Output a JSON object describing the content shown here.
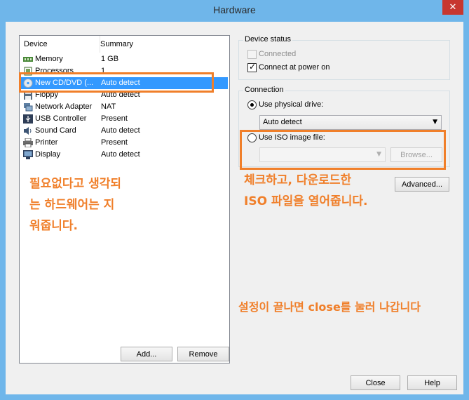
{
  "window": {
    "title": "Hardware"
  },
  "device_list": {
    "headers": {
      "device": "Device",
      "summary": "Summary"
    },
    "rows": [
      {
        "name": "Memory",
        "summary": "1 GB",
        "icon": "memory-icon"
      },
      {
        "name": "Processors",
        "summary": "1",
        "icon": "processor-icon"
      },
      {
        "name": "New CD/DVD (...",
        "summary": "Auto detect",
        "icon": "cd-dvd-icon",
        "selected": true
      },
      {
        "name": "Floppy",
        "summary": "Auto detect",
        "icon": "floppy-icon"
      },
      {
        "name": "Network Adapter",
        "summary": "NAT",
        "icon": "network-adapter-icon"
      },
      {
        "name": "USB Controller",
        "summary": "Present",
        "icon": "usb-icon"
      },
      {
        "name": "Sound Card",
        "summary": "Auto detect",
        "icon": "sound-card-icon"
      },
      {
        "name": "Printer",
        "summary": "Present",
        "icon": "printer-icon"
      },
      {
        "name": "Display",
        "summary": "Auto detect",
        "icon": "display-icon"
      }
    ]
  },
  "buttons": {
    "add": "Add...",
    "remove": "Remove",
    "advanced": "Advanced...",
    "close": "Close",
    "help": "Help",
    "browse": "Browse..."
  },
  "device_status": {
    "label": "Device status",
    "connected": {
      "label": "Connected",
      "checked": false,
      "enabled": false
    },
    "connect_at_power_on": {
      "label": "Connect at power on",
      "checked": true
    }
  },
  "connection": {
    "label": "Connection",
    "physical_drive": {
      "label": "Use physical drive:",
      "selected": true,
      "value": "Auto detect"
    },
    "iso_image": {
      "label": "Use ISO image file:",
      "selected": false,
      "value": ""
    }
  },
  "annotations": {
    "left_note": [
      "필요없다고 생각되",
      "는 하드웨어는 지",
      "워줍니다."
    ],
    "right_note": [
      "체크하고, 다운로드한",
      "ISO 파일을 열어줍니다."
    ],
    "bottom_note": "설정이 끝나면 close를 눌러 나갑니다"
  },
  "colors": {
    "accent": "#f07f2a",
    "selection": "#3399ff",
    "frame": "#6fb6ea",
    "close": "#c7372f"
  }
}
